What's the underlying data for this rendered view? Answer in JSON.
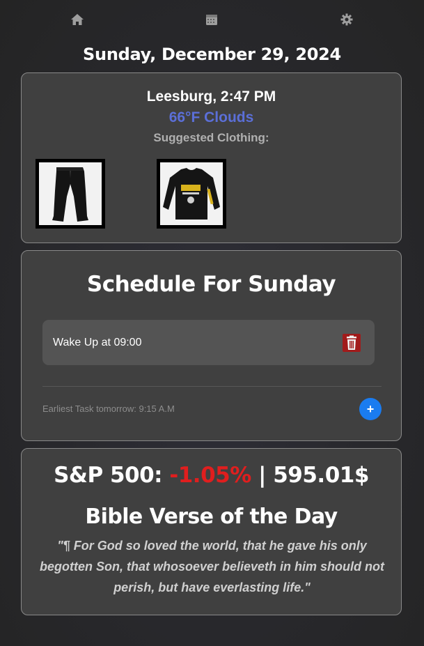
{
  "nav": {
    "icons": [
      "home-icon",
      "calendar-icon",
      "settings-gear-icon"
    ]
  },
  "date": "Sunday, December 29, 2024",
  "weather": {
    "location_time": "Leesburg, 2:47 PM",
    "temperature_condition": "66°F Clouds",
    "suggested_label": "Suggested Clothing:",
    "items": [
      "sweatpants-image",
      "steelers-long-sleeve-shirt-image"
    ]
  },
  "schedule": {
    "title": "Schedule For Sunday",
    "tasks": [
      {
        "label": "Wake Up at 09:00"
      }
    ],
    "earliest_tomorrow": "Earliest Task tomorrow: 9:15 A.M",
    "add_label": "+"
  },
  "market": {
    "label": "S&P 500:",
    "change": "-1.05%",
    "separator": "|",
    "price": "595.01$",
    "change_color": "#e01e1e"
  },
  "bible": {
    "title": "Bible Verse of the Day",
    "verse": "\"¶ For God so loved the world, that he gave his only begotten Son, that whosoever believeth in him should not perish, but have everlasting life.\""
  },
  "colors": {
    "accent_blue": "#1a7cf0",
    "temperature": "#5b6fd8",
    "trash_red": "#a11b1b"
  }
}
